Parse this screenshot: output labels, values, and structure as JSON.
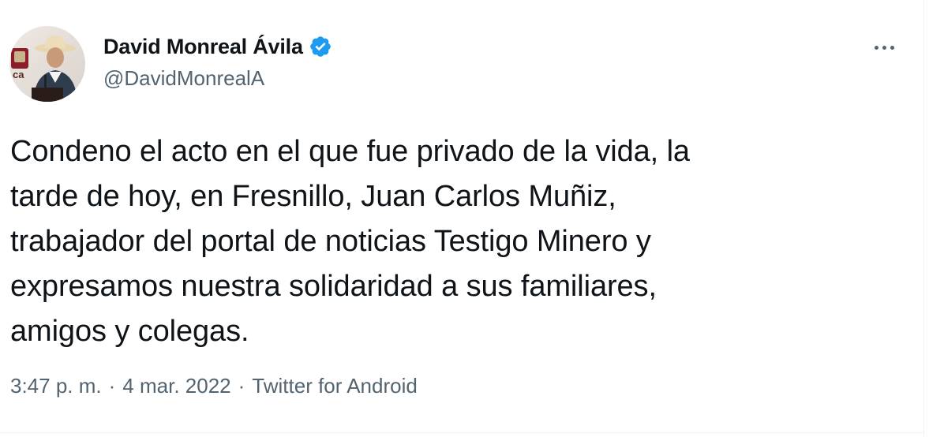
{
  "author": {
    "display_name": "David Monreal Ávila",
    "handle": "@DavidMonrealA",
    "verified": true,
    "avatar_icon": "profile-photo",
    "avatar_text": "ca"
  },
  "tweet": {
    "text_lines": [
      "Condeno el acto en el que fue privado de la vida, la",
      "tarde de hoy, en Fresnillo, Juan Carlos Muñiz,",
      "trabajador del portal de noticias Testigo Minero y",
      "expresamos nuestra solidaridad a sus familiares,",
      "amigos y colegas."
    ]
  },
  "meta": {
    "time": "3:47 p. m.",
    "separator": "·",
    "date": "4 mar. 2022",
    "source": "Twitter for Android"
  },
  "menu": {
    "icon": "more-options-icon"
  },
  "colors": {
    "text_primary": "#0f1419",
    "text_secondary": "#536471",
    "verified_blue": "#1d9bf0",
    "divider": "#eff3f4"
  }
}
